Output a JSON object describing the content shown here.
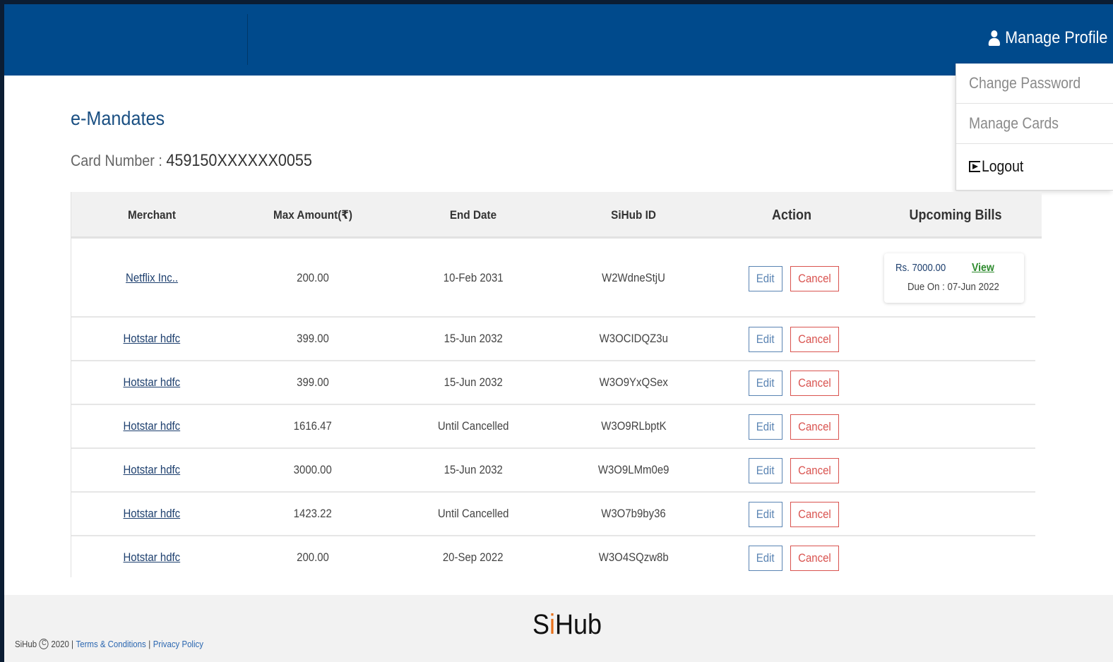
{
  "header": {
    "manage_profile_label": "Manage Profile",
    "user_icon": "user-icon",
    "background_color": "#004a8c"
  },
  "profile_menu": {
    "items": [
      {
        "label": "Change Password"
      },
      {
        "label": "Manage Cards"
      },
      {
        "label": "Logout",
        "icon": "logout-icon"
      }
    ]
  },
  "page": {
    "title": "e-Mandates",
    "card_number_label": "Card Number :",
    "card_number": "459150XXXXXX0055"
  },
  "table": {
    "columns": [
      "Merchant",
      "Max Amount(₹)",
      "End Date",
      "SiHub ID",
      "Action",
      "Upcoming Bills"
    ],
    "edit_label": "Edit",
    "cancel_label": "Cancel",
    "rows": [
      {
        "merchant": "Netflix Inc..",
        "max_amount": "200.00",
        "end_date": "10-Feb 2031",
        "sihub_id": "W2WdneStjU"
      },
      {
        "merchant": "Hotstar hdfc",
        "max_amount": "399.00",
        "end_date": "15-Jun 2032",
        "sihub_id": "W3OCIDQZ3u"
      },
      {
        "merchant": "Hotstar hdfc",
        "max_amount": "399.00",
        "end_date": "15-Jun 2032",
        "sihub_id": "W3O9YxQSex"
      },
      {
        "merchant": "Hotstar hdfc",
        "max_amount": "1616.47",
        "end_date": "Until Cancelled",
        "sihub_id": "W3O9RLbptK"
      },
      {
        "merchant": "Hotstar hdfc",
        "max_amount": "3000.00",
        "end_date": "15-Jun 2032",
        "sihub_id": "W3O9LMm0e9"
      },
      {
        "merchant": "Hotstar hdfc",
        "max_amount": "1423.22",
        "end_date": "Until Cancelled",
        "sihub_id": "W3O7b9by36"
      },
      {
        "merchant": "Hotstar hdfc",
        "max_amount": "200.00",
        "end_date": "20-Sep 2022",
        "sihub_id": "W3O4SQzw8b"
      }
    ],
    "upcoming_bill": {
      "amount": "Rs. 7000.00",
      "view_label": "View",
      "due": "Due On : 07-Jun 2022"
    }
  },
  "footer": {
    "logo_prefix": "S",
    "logo_i": "i",
    "logo_suffix": "Hub",
    "brand": "SiHub",
    "copyright_symbol": "C",
    "year_text": "2020 |",
    "terms_label": "Terms & Conditions",
    "separator": "|",
    "privacy_label": "Privacy Policy"
  }
}
